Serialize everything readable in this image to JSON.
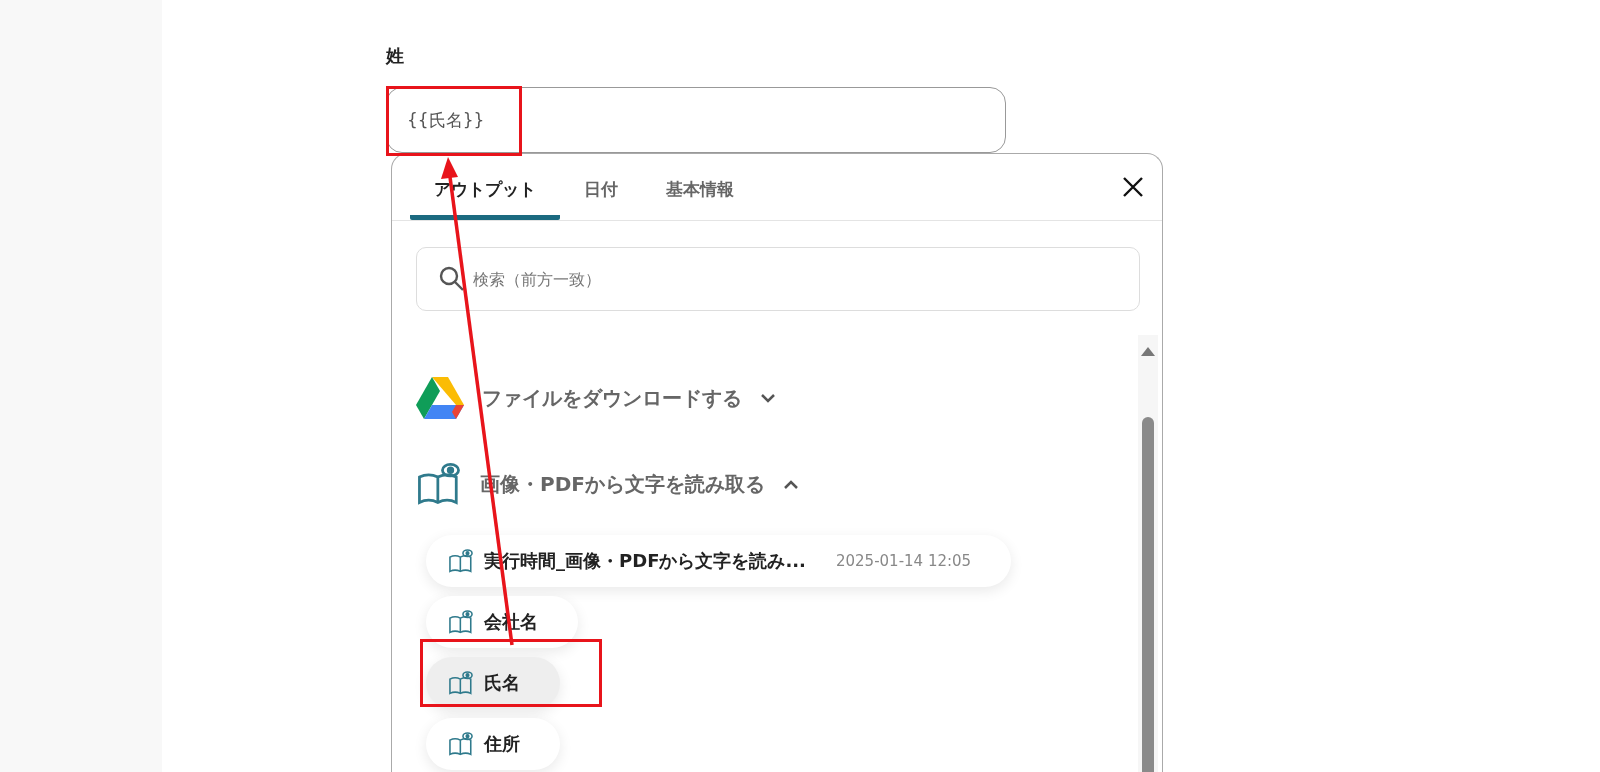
{
  "field": {
    "label": "姓",
    "value": "{{氏名}}"
  },
  "picker": {
    "tabs": [
      {
        "label": "アウトプット",
        "selected": true
      },
      {
        "label": "日付",
        "selected": false
      },
      {
        "label": "基本情報",
        "selected": false
      }
    ],
    "search": {
      "placeholder": "検索（前方一致）"
    },
    "groups": [
      {
        "kind": "drive",
        "title": "ファイルをダウンロードする",
        "expanded": false
      },
      {
        "kind": "ocr",
        "title": "画像・PDFから文字を読み取る",
        "expanded": true,
        "items": [
          {
            "label": "実行時間_画像・PDFから文字を読み...",
            "value": "2025-01-14 12:05",
            "selected": false
          },
          {
            "label": "会社名",
            "selected": false
          },
          {
            "label": "氏名",
            "selected": true
          },
          {
            "label": "住所",
            "selected": false
          }
        ]
      }
    ]
  }
}
